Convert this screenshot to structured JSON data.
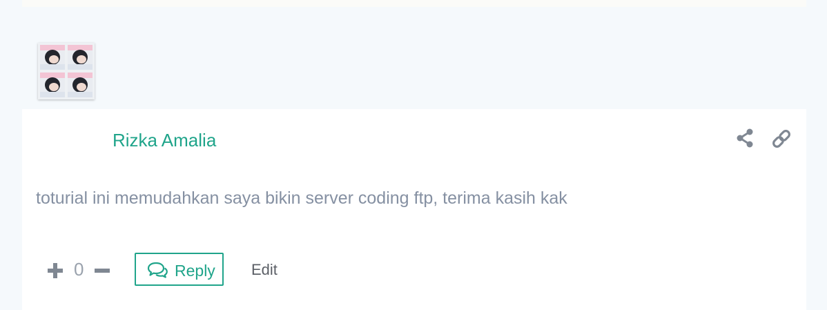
{
  "comment": {
    "author": "Rizka Amalia",
    "text": "toturial ini memudahkan saya bikin server coding ftp, terima kasih kak",
    "votes": {
      "count": "0",
      "upvote_icon": "plus-icon",
      "downvote_icon": "minus-icon"
    },
    "actions": {
      "reply_label": "Reply",
      "reply_icon": "comments-icon",
      "edit_label": "Edit",
      "share_icon": "share-icon",
      "permalink_icon": "link-icon"
    }
  },
  "colors": {
    "accent": "#1fa48a",
    "body_text": "#8590a2",
    "page_background": "#f5f9fc",
    "card_background": "#ffffff"
  }
}
